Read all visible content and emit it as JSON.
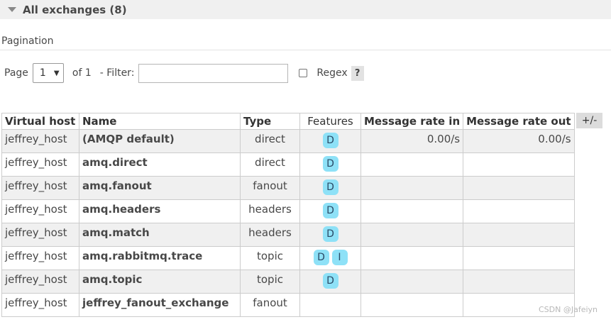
{
  "section": {
    "title": "All exchanges (8)"
  },
  "pagination": {
    "label": "Pagination",
    "page_label": "Page",
    "page_value": "1",
    "of_label": "of 1",
    "filter_label": "- Filter:",
    "filter_value": "",
    "regex_label": "Regex",
    "regex_checked": false,
    "help_label": "?"
  },
  "table": {
    "headers": [
      "Virtual host",
      "Name",
      "Type",
      "Features",
      "Message rate in",
      "Message rate out"
    ],
    "columns_toggle": "+/-",
    "rows": [
      {
        "vhost": "jeffrey_host",
        "name": "(AMQP default)",
        "type": "direct",
        "features": [
          "D"
        ],
        "rate_in": "0.00/s",
        "rate_out": "0.00/s"
      },
      {
        "vhost": "jeffrey_host",
        "name": "amq.direct",
        "type": "direct",
        "features": [
          "D"
        ],
        "rate_in": "",
        "rate_out": ""
      },
      {
        "vhost": "jeffrey_host",
        "name": "amq.fanout",
        "type": "fanout",
        "features": [
          "D"
        ],
        "rate_in": "",
        "rate_out": ""
      },
      {
        "vhost": "jeffrey_host",
        "name": "amq.headers",
        "type": "headers",
        "features": [
          "D"
        ],
        "rate_in": "",
        "rate_out": ""
      },
      {
        "vhost": "jeffrey_host",
        "name": "amq.match",
        "type": "headers",
        "features": [
          "D"
        ],
        "rate_in": "",
        "rate_out": ""
      },
      {
        "vhost": "jeffrey_host",
        "name": "amq.rabbitmq.trace",
        "type": "topic",
        "features": [
          "D",
          "I"
        ],
        "rate_in": "",
        "rate_out": ""
      },
      {
        "vhost": "jeffrey_host",
        "name": "amq.topic",
        "type": "topic",
        "features": [
          "D"
        ],
        "rate_in": "",
        "rate_out": ""
      },
      {
        "vhost": "jeffrey_host",
        "name": "jeffrey_fanout_exchange",
        "type": "fanout",
        "features": [],
        "rate_in": "",
        "rate_out": ""
      }
    ]
  },
  "watermark": "CSDN @Jafeiyn",
  "colors": {
    "badge": "#8ee1f7",
    "row_alt": "#f0f0f0",
    "header_bar": "#f0f0f0"
  }
}
